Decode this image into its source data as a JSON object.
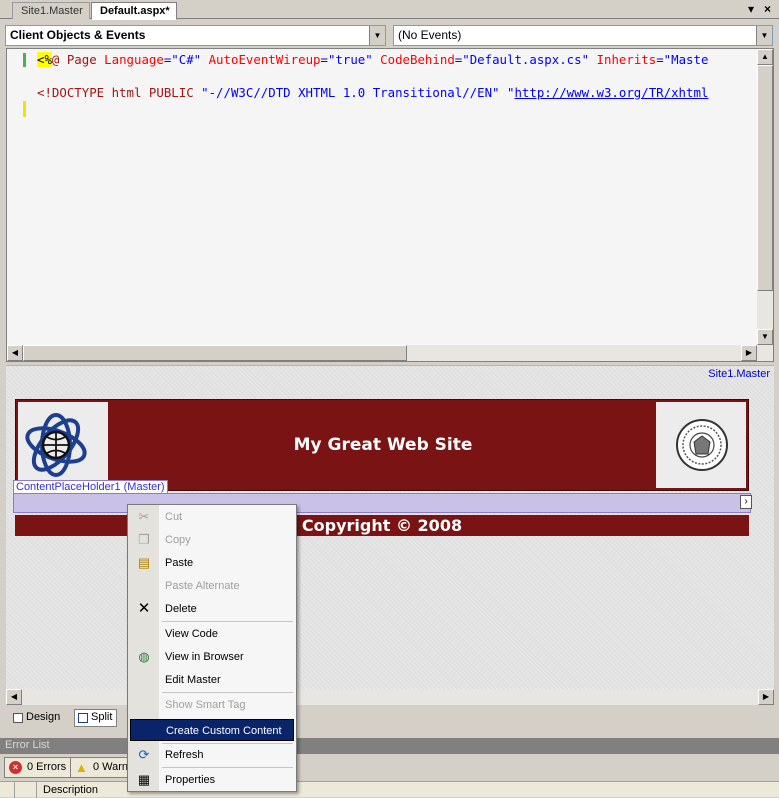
{
  "tabs": [
    {
      "label": "Site1.Master",
      "active": false
    },
    {
      "label": "Default.aspx*",
      "active": true
    }
  ],
  "tab_controls": {
    "dropdown_glyph": "▾",
    "close_glyph": "×"
  },
  "dropdowns": {
    "objects": "Client Objects & Events",
    "events": "(No Events)"
  },
  "code_lines": {
    "line1": {
      "open": "<%",
      "directive": "@ Page",
      "a1": " Language",
      "v1": "=\"C#\"",
      "a2": " AutoEventWireup",
      "v2": "=\"true\"",
      "a3": " CodeBehind",
      "v3": "=\"Default.aspx.cs\"",
      "a4": " Inherits",
      "v4": "=\"Maste"
    },
    "line2": {
      "open": "<!DOCTYPE html PUBLIC",
      "dtd": " \"-//W3C//DTD XHTML 1.0 Transitional//EN\"",
      "quote": " \"",
      "url": "http://www.w3.org/TR/xhtml"
    }
  },
  "design": {
    "master_label": "Site1.Master",
    "site_title": "My Great Web Site",
    "placeholder_label": "ContentPlaceHolder1 (Master)",
    "footer": "Copyright © 2008",
    "smart_tag_glyph": "›"
  },
  "view_buttons": {
    "design": "Design",
    "split": "Split"
  },
  "error_list": {
    "title": "Error List",
    "errors": "0 Errors",
    "warnings": "0 Warn",
    "description_header": "Description"
  },
  "context_menu": {
    "items": [
      {
        "label": "Cut",
        "icon": "scissors-icon",
        "enabled": false
      },
      {
        "label": "Copy",
        "icon": "copy-icon",
        "enabled": false
      },
      {
        "label": "Paste",
        "icon": "paste-icon",
        "enabled": true
      },
      {
        "label": "Paste Alternate",
        "icon": "",
        "enabled": false
      },
      {
        "label": "Delete",
        "icon": "delete-icon",
        "enabled": true
      },
      {
        "label": "View Code",
        "icon": "",
        "enabled": true
      },
      {
        "label": "View in Browser",
        "icon": "browser-icon",
        "enabled": true
      },
      {
        "label": "Edit Master",
        "icon": "",
        "enabled": true
      },
      {
        "label": "Show Smart Tag",
        "icon": "",
        "enabled": false
      },
      {
        "label": "Create Custom Content",
        "icon": "",
        "enabled": true,
        "highlighted": true
      },
      {
        "label": "Refresh",
        "icon": "refresh-icon",
        "enabled": true
      },
      {
        "label": "Properties",
        "icon": "properties-icon",
        "enabled": true
      }
    ]
  },
  "colors": {
    "banner": "#7a1414",
    "placeholder": "#c9c1e6",
    "menu_highlight": "#0a246a"
  }
}
